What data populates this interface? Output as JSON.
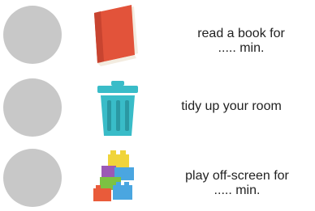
{
  "tasks": [
    {
      "icon": "book-icon",
      "line1": "read a book for",
      "line2": "..... min."
    },
    {
      "icon": "trash-bin-icon",
      "line1": "tidy up your room"
    },
    {
      "icon": "building-blocks-icon",
      "line1": "play off-screen for",
      "line2": "..... min."
    }
  ],
  "colors": {
    "check_circle": "#c8c8c8",
    "book_red": "#e2533a",
    "bin_teal": "#39bcc8",
    "blocks": [
      "#f0d43a",
      "#4aa6e0",
      "#7cc242",
      "#e95b3a",
      "#9b59b6"
    ]
  }
}
